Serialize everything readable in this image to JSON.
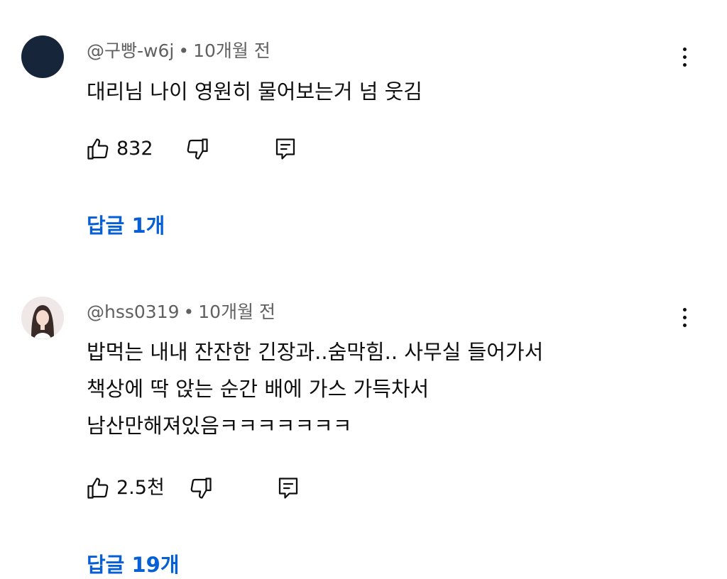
{
  "comments": [
    {
      "author": "@구빵-w6j",
      "separator": "•",
      "time": "10개월 전",
      "avatar_icon": "dark-avatar",
      "lines": [
        "대리님 나이 영원히 물어보는거 넘 웃김"
      ],
      "likes": "832",
      "replies": "답글 1개"
    },
    {
      "author": "@hss0319",
      "separator": "•",
      "time": "10개월 전",
      "avatar_icon": "profile-photo-avatar",
      "lines": [
        "밥먹는 내내 잔잔한 긴장과..숨막힘.. 사무실 들어가서",
        "책상에 딱 앉는 순간 배에 가스 가득차서",
        "남산만해져있음ㅋㅋㅋㅋㅋㅋㅋ"
      ],
      "likes": "2.5천",
      "replies": "답글 19개"
    }
  ],
  "colors": {
    "reply_link": "#065fd4",
    "meta_text": "#606060",
    "body_text": "#0f0f0f"
  },
  "icons": {
    "like": "thumbs-up-icon",
    "dislike": "thumbs-down-icon",
    "reply": "reply-comment-icon",
    "more": "more-vertical-icon"
  }
}
